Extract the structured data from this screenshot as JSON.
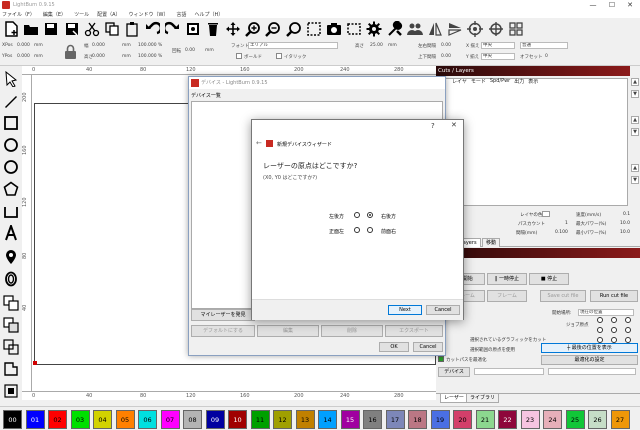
{
  "window": {
    "title": "LightBurn 0.9.15",
    "min": "—",
    "max": "☐",
    "close": "✕"
  },
  "menu": [
    "ファイル（F）",
    "編集（E）",
    "ツール",
    "配置（A）",
    "ウィンドウ（W）",
    "言語",
    "ヘルプ（H）"
  ],
  "toolbar_icons": [
    "new-file-icon",
    "open-folder-icon",
    "save-icon",
    "save-as-icon",
    "cut-icon",
    "copy-icon",
    "paste-icon",
    "undo-icon",
    "redo-icon",
    "trace-icon",
    "delete-icon",
    "move-icon",
    "zoom-in-icon",
    "zoom-out-icon",
    "zoom-fit-icon",
    "frame-select-icon",
    "camera-icon",
    "rectangle-select-icon",
    "settings-gear-icon",
    "tools-icon",
    "users-icon",
    "mirror-h-icon",
    "mirror-v-icon",
    "target-icon",
    "align-center-icon",
    "grid-icon"
  ],
  "props": {
    "xpos_label": "XPos",
    "xpos_value": "0.000",
    "ypos_label": "YPos",
    "ypos_value": "0.000",
    "width_label": "幅",
    "width_value": "0.000",
    "height_label": "高さ",
    "height_value": "0.000",
    "unit": "mm",
    "pct_w": "100.000",
    "pct_h": "100.000",
    "pct": "%",
    "rotate_label": "回転",
    "rotate_value": "0.00",
    "font_label": "フォント",
    "font_value": "エリアル",
    "size_label": "高さ",
    "size_value": "25.00",
    "hspace_label": "左右間隔",
    "hspace_value": "0.00",
    "vspace_label": "上下間隔",
    "vspace_value": "0.00",
    "bold_label": "ボールド",
    "italic_label": "イタリック",
    "xalign_label": "X 揃え",
    "xalign_value": "中央",
    "yalign_label": "Y 揃え",
    "yalign_value": "中央",
    "mode_value": "普通",
    "offset_label": "オフセット",
    "offset_value": "0"
  },
  "left_tools": [
    "select-arrow-icon",
    "edit-nodes-icon",
    "rectangle-tool-icon",
    "ellipse-tool-icon",
    "polygon-tool-icon",
    "pentagon-tool-icon",
    "corner-tool-icon",
    "text-tool-icon",
    "location-pin-icon",
    "offset-icon",
    "boolean-union-icon",
    "boolean-diff-icon",
    "boolean-intersect-icon",
    "weld-icon",
    "align-icon"
  ],
  "ruler": {
    "top": [
      "0",
      "40",
      "80",
      "120",
      "160",
      "200",
      "240",
      "280"
    ],
    "left": [
      "200",
      "160",
      "120",
      "80",
      "40"
    ],
    "bottom": [
      "0",
      "40",
      "80",
      "120",
      "160",
      "200",
      "240",
      "280"
    ]
  },
  "cuts": {
    "header": "Cuts / Layers",
    "columns": [
      "レイヤ",
      "モード",
      "Spd/Pwr",
      "出力",
      "表示"
    ],
    "color_label": "レイヤの色",
    "speed_label": "速度(mm/s)",
    "speed_value": "0.1",
    "passes_label": "パスカウント",
    "passes_value": "1",
    "maxpower_label": "最大パワー(%)",
    "maxpower_value": "10.0",
    "interval_label": "間隔(mm)",
    "interval_value": "0.100",
    "minpower_label": "最小パワー(%)",
    "minpower_value": "10.0"
  },
  "tabs": {
    "layers": "Layers",
    "move": "移動"
  },
  "laser": {
    "start": "▶ 開始",
    "pause": "‖ 一時停止",
    "stop": "■ 停止",
    "frame1": "フレーム",
    "frame2": "フレーム",
    "save_gcode": "Save cut file",
    "run_gcode": "Run cut file",
    "start_from_label": "開始場所:",
    "start_from_value": "現在の位置",
    "job_origin_label": "ジョブ原点",
    "cut_selected": "選択されているグラフィックをカット",
    "use_selection_origin": "選択範囲の原点を使用",
    "optimize": "カットパスを最適化",
    "optimize_settings": "最適化の設定",
    "move_to_best": "┼ 最後の位置を表示",
    "device_label": "デバイス"
  },
  "bottom_tabs": {
    "laser": "レーザー",
    "library": "ライブラリ"
  },
  "palette": [
    {
      "n": "00",
      "c": "#000000",
      "t": "#ffffff"
    },
    {
      "n": "01",
      "c": "#0000ff",
      "t": "#ffffff"
    },
    {
      "n": "02",
      "c": "#ff0000",
      "t": "#000000"
    },
    {
      "n": "03",
      "c": "#00e000",
      "t": "#000000"
    },
    {
      "n": "04",
      "c": "#d2d200",
      "t": "#000000"
    },
    {
      "n": "05",
      "c": "#ff8000",
      "t": "#000000"
    },
    {
      "n": "06",
      "c": "#00e0e0",
      "t": "#000000"
    },
    {
      "n": "07",
      "c": "#ff00ff",
      "t": "#000000"
    },
    {
      "n": "08",
      "c": "#b4b4b4",
      "t": "#000000"
    },
    {
      "n": "09",
      "c": "#0000a0",
      "t": "#ffffff"
    },
    {
      "n": "10",
      "c": "#a00000",
      "t": "#ffffff"
    },
    {
      "n": "11",
      "c": "#00a000",
      "t": "#000000"
    },
    {
      "n": "12",
      "c": "#a0a000",
      "t": "#000000"
    },
    {
      "n": "13",
      "c": "#c08000",
      "t": "#000000"
    },
    {
      "n": "14",
      "c": "#00a0ff",
      "t": "#000000"
    },
    {
      "n": "15",
      "c": "#a000a0",
      "t": "#ffffff"
    },
    {
      "n": "16",
      "c": "#808080",
      "t": "#000000"
    },
    {
      "n": "17",
      "c": "#7d87b9",
      "t": "#000000"
    },
    {
      "n": "18",
      "c": "#bb7784",
      "t": "#000000"
    },
    {
      "n": "19",
      "c": "#4a6fe3",
      "t": "#000000"
    },
    {
      "n": "20",
      "c": "#d33f6a",
      "t": "#000000"
    },
    {
      "n": "21",
      "c": "#8cd78f",
      "t": "#000000"
    },
    {
      "n": "22",
      "c": "#8e063b",
      "t": "#ffffff"
    },
    {
      "n": "23",
      "c": "#f6c4e1",
      "t": "#000000"
    },
    {
      "n": "24",
      "c": "#e6afb9",
      "t": "#000000"
    },
    {
      "n": "25",
      "c": "#11c638",
      "t": "#000000"
    },
    {
      "n": "26",
      "c": "#c6dec7",
      "t": "#000000"
    },
    {
      "n": "27",
      "c": "#ef9708",
      "t": "#000000"
    }
  ],
  "devices_dialog": {
    "title": "デバイス - LightBurn 0.9.15",
    "list_label": "デバイス一覧",
    "find_btn": "マイレーザーを発見",
    "default_btn": "デフォルトにする",
    "edit_btn": "編集",
    "delete_btn": "削除",
    "export_btn": "エクスポート",
    "ok_btn": "OK",
    "cancel_btn": "Cancel"
  },
  "wizard": {
    "title": "新規デバイスウィザード",
    "help": "?",
    "close": "✕",
    "back": "←",
    "question": "レーザーの原点はどこですか?",
    "subtitle": "(X0, Y0 はどこですか?)",
    "options": [
      {
        "label": "左後方",
        "selected": false
      },
      {
        "label": "右後方",
        "selected": true
      },
      {
        "label": "正面左",
        "selected": false
      },
      {
        "label": "前面右",
        "selected": false
      }
    ],
    "next_btn": "Next",
    "cancel_btn": "Cancel"
  }
}
